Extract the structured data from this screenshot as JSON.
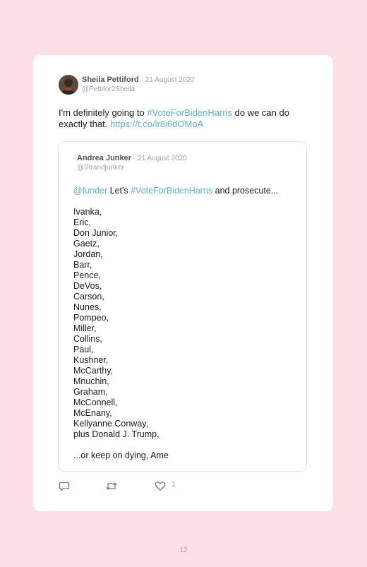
{
  "tweet": {
    "author_name": "Sheila Pettiford",
    "date": "· 21 August 2020",
    "handle": "@Pettifor2Sheila",
    "text_before": "I'm definitely going to ",
    "hashtag": "#VoteForBidenHarris",
    "text_after": " do we can do exactly that. ",
    "link": "https://t.co/lr8i6dOMoA"
  },
  "quoted_tweet": {
    "author_name": "Andrea Junker",
    "date": "· 21 August 2020",
    "handle": "@Strandjunker",
    "mention": "@funder",
    "text_mid": " Let's ",
    "hashtag": "#VoteForBidenHarris",
    "text_end": " and prosecute...",
    "names": [
      "Ivanka,",
      "Eric,",
      "Don Junior,",
      "Gaetz,",
      "Jordan,",
      "Barr,",
      "Pence,",
      "DeVos,",
      "Carson,",
      "Nunes,",
      "Pompeo,",
      "Miller,",
      "Collins,",
      "Paul,",
      "Kushner,",
      "McCarthy,",
      "Mnuchin,",
      "Graham,",
      "McConnell,",
      "McEnany,",
      "Kellyanne Conway,",
      "plus Donald J. Trump,"
    ],
    "closing": "...or keep on dying, Ame"
  },
  "actions": {
    "reply_icon": "reply-icon",
    "retweet_icon": "retweet-icon",
    "like_icon": "heart-icon",
    "like_count": "1"
  },
  "page_number": "12",
  "colors": {
    "background": "#fde0e5",
    "card": "#ffffff",
    "link": "#5bb0e6",
    "muted": "#9aa3ae"
  }
}
